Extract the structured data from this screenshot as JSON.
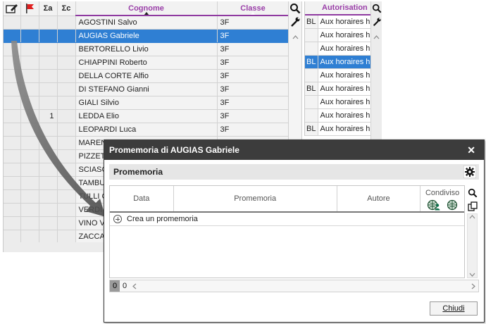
{
  "grid": {
    "columns": {
      "sum_a": "Σa",
      "sum_c": "Σc",
      "surname": "Cognome",
      "class": "Classe"
    },
    "rows": [
      {
        "count": "",
        "name": "AGOSTINI Salvo",
        "class": "3F"
      },
      {
        "count": "",
        "name": "AUGIAS Gabriele",
        "class": "3F"
      },
      {
        "count": "",
        "name": "BERTORELLO Livio",
        "class": "3F"
      },
      {
        "count": "",
        "name": "CHIAPPINI Roberto",
        "class": "3F"
      },
      {
        "count": "",
        "name": "DELLA CORTE Alfio",
        "class": "3F"
      },
      {
        "count": "",
        "name": "DI STEFANO Gianni",
        "class": "3F"
      },
      {
        "count": "",
        "name": "GIALI Silvio",
        "class": "3F"
      },
      {
        "count": "1",
        "name": "LEDDA Elio",
        "class": "3F"
      },
      {
        "count": "",
        "name": "LEOPARDI Luca",
        "class": "3F"
      },
      {
        "count": "",
        "name": "MAREN",
        "class": ""
      },
      {
        "count": "",
        "name": "PIZZET",
        "class": ""
      },
      {
        "count": "",
        "name": "SCIASC",
        "class": ""
      },
      {
        "count": "",
        "name": "TAMBU",
        "class": ""
      },
      {
        "count": "",
        "name": "TULLI G",
        "class": ""
      },
      {
        "count": "",
        "name": "VERDI",
        "class": ""
      },
      {
        "count": "",
        "name": "VINO V",
        "class": ""
      },
      {
        "count": "",
        "name": "ZACCA",
        "class": ""
      }
    ]
  },
  "grid2": {
    "header": "Autorisation",
    "rows": [
      {
        "code": "BL",
        "text": "Aux horaires h"
      },
      {
        "code": "",
        "text": "Aux horaires h"
      },
      {
        "code": "",
        "text": "Aux horaires h"
      },
      {
        "code": "BL",
        "text": "Aux horaires h"
      },
      {
        "code": "",
        "text": "Aux horaires h"
      },
      {
        "code": "BL",
        "text": "Aux horaires h"
      },
      {
        "code": "",
        "text": "Aux horaires h"
      },
      {
        "code": "",
        "text": "Aux horaires h"
      },
      {
        "code": "BL",
        "text": "Aux horaires h"
      }
    ]
  },
  "dialog": {
    "title": "Promemoria di AUGIAS Gabriele",
    "close_glyph": "✕",
    "section": "Promemoria",
    "table": {
      "col_data": "Data",
      "col_promemoria": "Promemoria",
      "col_autore": "Autore",
      "col_condiviso": "Condiviso"
    },
    "create_label": "Crea un promemoria",
    "count_a": "0",
    "count_b": "0",
    "close_button": "Chiudi"
  },
  "colors": {
    "accent_purple": "#9a3fa8",
    "selection_blue": "#2f7fd3",
    "dialog_title_bg": "#3c3c3c"
  }
}
